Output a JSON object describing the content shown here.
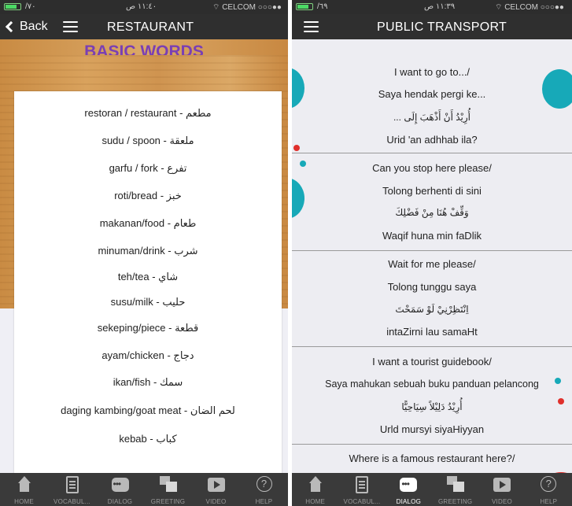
{
  "left": {
    "status": {
      "carrier": "/٧٠",
      "time": "١١:٤٠ ص",
      "network": "CELCOM"
    },
    "nav": {
      "back": "Back",
      "title": "RESTAURANT"
    },
    "section_title": "BASIC WORDS",
    "words": [
      "restoran / restaurant - مطعم",
      "sudu / spoon - ملعقة",
      "garfu / fork - تفرع",
      "roti/bread - خبز",
      "makanan/food - طعام",
      "minuman/drink - شرب",
      "teh/tea - شاي",
      "susu/milk - حليب",
      "sekeping/piece - قطعة",
      "ayam/chicken - دجاج",
      "ikan/fish - سمك",
      "daging kambing/goat meat - لحم الضان",
      "kebab - كباب"
    ]
  },
  "right": {
    "status": {
      "carrier": "/٦٩",
      "time": "١١:٣٩ ص",
      "network": "CELCOM"
    },
    "nav": {
      "title": "PUBLIC TRANSPORT"
    },
    "phrases": [
      {
        "en": "I want to go to.../",
        "ms": "Saya hendak pergi ke...",
        "ar": "... أُرِيْدُ أَنْ أَذْهَبَ إِلَى",
        "tr": "Urid 'an adhhab ila?"
      },
      {
        "en": "Can you stop here please/",
        "ms": "Tolong berhenti di sini",
        "ar": "وَقِّفْ هُنَا مِنْ فَضْلِكَ",
        "tr": "Waqif huna min faDlik"
      },
      {
        "en": "Wait for me please/",
        "ms": "Tolong tunggu saya",
        "ar": "اِنْتَظِرْنِيْ لَوْ سَمَحْتَ",
        "tr": "intaZirni lau samaHt"
      },
      {
        "en": "I want a tourist guidebook/",
        "ms": "Saya mahukan sebuah buku panduan pelancong",
        "ar": "أُرِيْدُ دَلِيْلاً سِيَاحِيًّا",
        "tr": "Urld mursyi siyaHiyyan"
      },
      {
        "en": "Where is a famous restaurant here?/"
      }
    ]
  },
  "tabs": [
    {
      "label": "HOME",
      "icon": "home-icon"
    },
    {
      "label": "VOCABUL...",
      "icon": "book-icon"
    },
    {
      "label": "DIALOG",
      "icon": "chat-icon"
    },
    {
      "label": "GREETING",
      "icon": "greeting-icon"
    },
    {
      "label": "VIDEO",
      "icon": "video-icon"
    },
    {
      "label": "HELP",
      "icon": "help-icon"
    }
  ],
  "colors": {
    "accent_purple": "#7a3fb4",
    "teal": "#17a9b8",
    "red": "#e0302c",
    "navbar": "#2f2f2f"
  }
}
